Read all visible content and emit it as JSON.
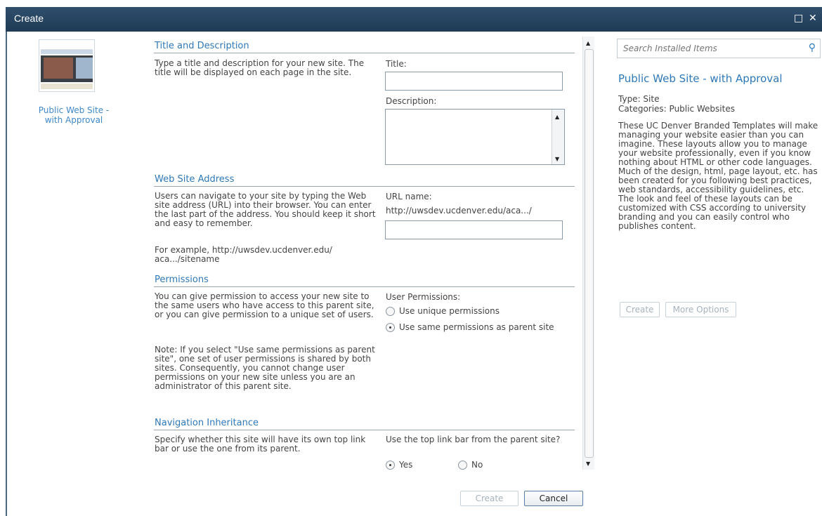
{
  "window": {
    "title": "Create",
    "maximize_icon": "maximize-icon",
    "close_icon": "close-icon"
  },
  "template": {
    "name": "Public Web Site - with Approval"
  },
  "sections": {
    "title_desc": {
      "heading": "Title and Description",
      "description": "Type a title and description for your new site. The title will be displayed on each page in the site.",
      "title_label": "Title:",
      "title_value": "",
      "description_label": "Description:",
      "description_value": ""
    },
    "address": {
      "heading": "Web Site Address",
      "description": "Users can navigate to your site by typing the Web site address (URL) into their browser. You can enter the last part of the address. You should keep it short and easy to remember.",
      "example": "For example, http://uwsdev.ucdenver.edu/ aca.../sitename",
      "url_label": "URL name:",
      "url_prefix": "http://uwsdev.ucdenver.edu/aca.../",
      "url_value": ""
    },
    "permissions": {
      "heading": "Permissions",
      "description": "You can give permission to access your new site to the same users who have access to this parent site, or you can give permission to a unique set of users.",
      "note": "Note: If you select \"Use same permissions as parent site\", one set of user permissions is shared by both sites. Consequently, you cannot change user permissions on your new site unless you are an administrator of this parent site.",
      "label": "User Permissions:",
      "options": [
        "Use unique permissions",
        "Use same permissions as parent site"
      ],
      "selected": "Use same permissions as parent site"
    },
    "navigation": {
      "heading": "Navigation Inheritance",
      "description": "Specify whether this site will have its own top link bar or use the one from its parent.",
      "question": "Use the top link bar from the parent site?",
      "options": [
        "Yes",
        "No"
      ],
      "selected": "Yes"
    }
  },
  "buttons": {
    "create": "Create",
    "cancel": "Cancel"
  },
  "sidebar": {
    "search_placeholder": "Search Installed Items",
    "title": "Public Web Site - with Approval",
    "type": "Type: Site",
    "categories": "Categories: Public Websites",
    "description": "These UC Denver Branded Templates will make managing your website easier than you can imagine. These layouts allow you to manage your website professionally, even if you know nothing about HTML or other code languages. Much of the design, html, page layout, etc. has been created for you following best practices, web standards, accessibility guidelines, etc.  The look and feel of these layouts can be customized with CSS according to university branding and you can easily control who publishes content.",
    "create_label": "Create",
    "more_options_label": "More Options"
  }
}
